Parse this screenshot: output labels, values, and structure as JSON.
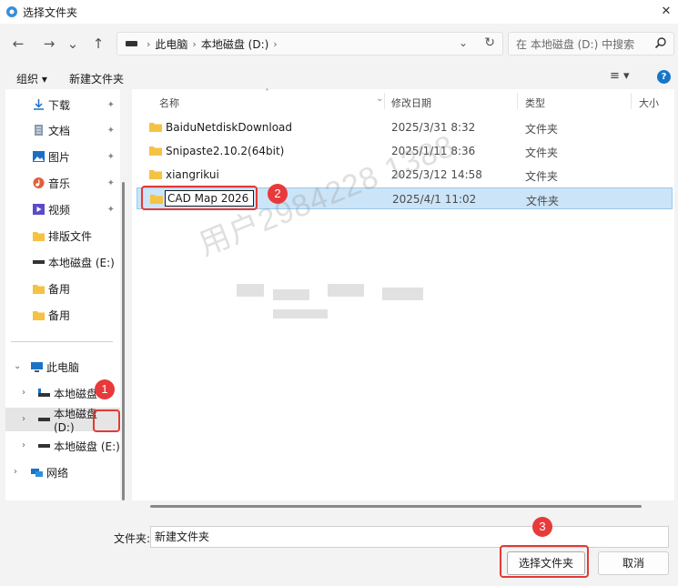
{
  "window": {
    "title": "选择文件夹",
    "close_glyph": "✕"
  },
  "nav": {
    "back": "←",
    "forward": "→",
    "recent": "⌄",
    "up": "↑",
    "breadcrumb": [
      "此电脑",
      "本地磁盘 (D:)"
    ],
    "breadcrumb_sep": "›",
    "dropdown": "⌄",
    "refresh": "↻",
    "search_placeholder": "在 本地磁盘 (D:) 中搜索"
  },
  "cmdbar": {
    "organize": "组织 ▾",
    "new_folder": "新建文件夹",
    "view": "≡ ▾",
    "help": "?"
  },
  "sidebar": {
    "quick": [
      {
        "label": "下载",
        "icon": "download-icon"
      },
      {
        "label": "文档",
        "icon": "document-icon"
      },
      {
        "label": "图片",
        "icon": "picture-icon"
      },
      {
        "label": "音乐",
        "icon": "music-icon"
      },
      {
        "label": "视频",
        "icon": "video-icon"
      },
      {
        "label": "排版文件",
        "icon": "folder-icon"
      },
      {
        "label": "本地磁盘 (E:)",
        "icon": "drive-icon"
      },
      {
        "label": "备用",
        "icon": "folder-icon"
      },
      {
        "label": "备用",
        "icon": "folder-icon"
      }
    ],
    "pin_glyph": "📌",
    "this_pc": "此电脑",
    "drives": [
      {
        "label": "本地磁盘",
        "icon": "drive-icon"
      },
      {
        "label": "本地磁盘 (D:)",
        "icon": "drive-icon"
      },
      {
        "label": "本地磁盘 (E:)",
        "icon": "drive-icon"
      }
    ],
    "network": "网络"
  },
  "columns": {
    "name": "名称",
    "date": "修改日期",
    "type": "类型",
    "size": "大小"
  },
  "rows": [
    {
      "name": "BaiduNetdiskDownload",
      "date": "2025/3/31 8:32",
      "type": "文件夹"
    },
    {
      "name": "Snipaste2.10.2(64bit)",
      "date": "2025/1/11 8:36",
      "type": "文件夹"
    },
    {
      "name": "xiangrikui",
      "date": "2025/3/12 14:58",
      "type": "文件夹"
    },
    {
      "name": "CAD Map 2026",
      "date": "2025/4/1 11:02",
      "type": "文件夹"
    }
  ],
  "bottom": {
    "folder_label": "文件夹:",
    "folder_value": "新建文件夹",
    "select_button": "选择文件夹",
    "cancel_button": "取消"
  },
  "annotations": [
    "1",
    "2",
    "3"
  ],
  "watermark": "用户2984228 1388"
}
